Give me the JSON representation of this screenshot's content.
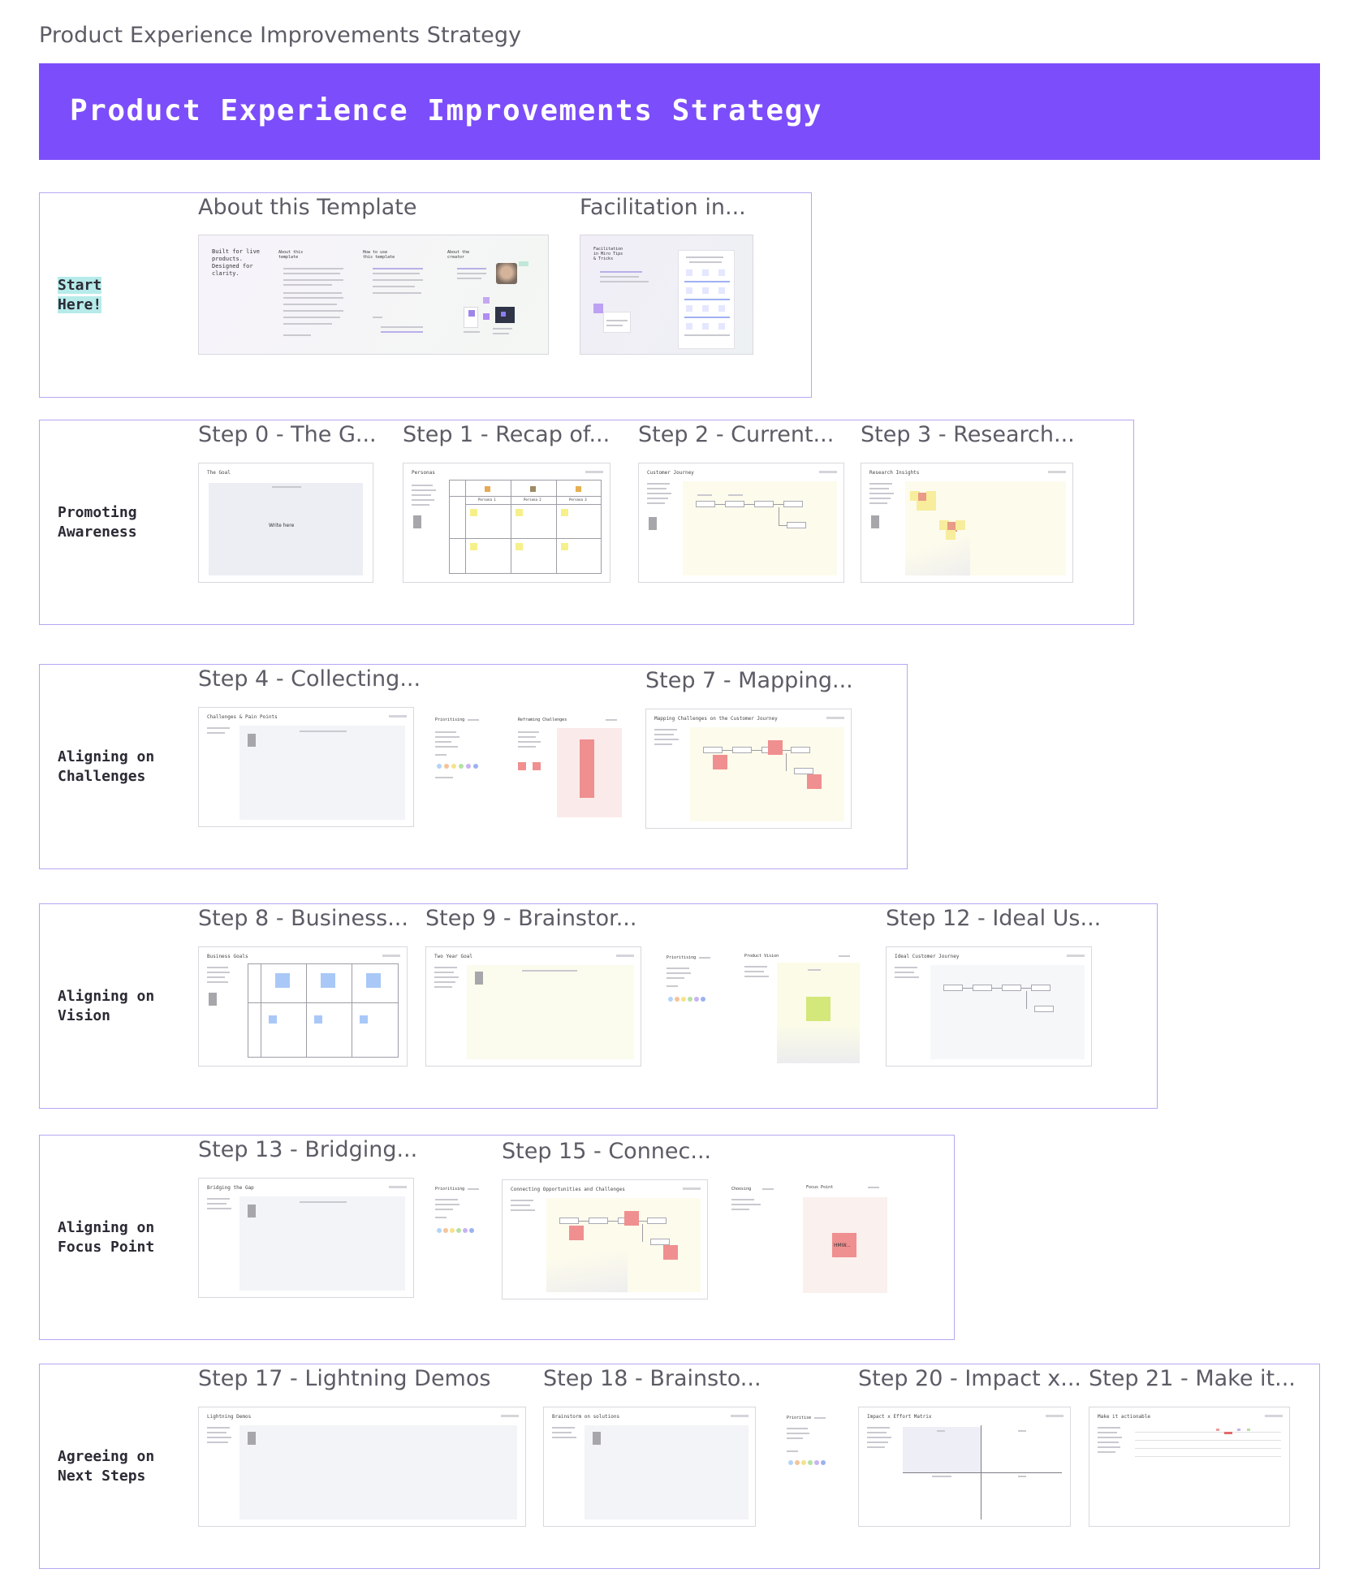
{
  "breadcrumb": "Product Experience Improvements Strategy",
  "banner": {
    "title": "Product Experience Improvements Strategy",
    "color": "#7c4dfa"
  },
  "sections": [
    {
      "label": "Start\nHere!",
      "cards": [
        "About this Template",
        "Facilitation in..."
      ]
    },
    {
      "label": "Promoting\nAwareness",
      "cards": [
        "Step 0 - The G...",
        "Step 1 - Recap of...",
        "Step 2 - Current...",
        "Step 3 - Research..."
      ]
    },
    {
      "label": "Aligning on\nChallenges",
      "cards": [
        "Step 4 - Collecting...",
        "Step 7 - Mapping..."
      ]
    },
    {
      "label": "Aligning on\nVision",
      "cards": [
        "Step 8 - Business...",
        "Step 9 - Brainstor...",
        "Step 12 - Ideal Us..."
      ]
    },
    {
      "label": "Aligning on\nFocus Point",
      "cards": [
        "Step 13 - Bridging...",
        "Step 15 - Connec..."
      ]
    },
    {
      "label": "Agreeing on\nNext Steps",
      "cards": [
        "Step 17 - Lightning Demos",
        "Step 18 - Brainsto...",
        "Step 20 - Impact x...",
        "Step 21 - Make it..."
      ]
    }
  ],
  "thumbs": {
    "about_intro": "Built for live\nproducts.\nDesigned for\nclarity.",
    "about_col1": "About this\ntemplate",
    "about_col2": "How to use\nthis template",
    "about_col3": "About the\ncreator",
    "facilitation": "Facilitation\nin Miro Tips\n& Tricks",
    "goal": "The Goal",
    "write_here": "Write here",
    "personas": "Personas",
    "persona_1": "Persona 1",
    "persona_2": "Persona 2",
    "persona_3": "Persona 3",
    "customer_journey": "Customer Journey",
    "research_insights": "Research Insights",
    "challenges": "Challenges & Pain Points",
    "prioritising": "Prioritising",
    "reframing": "Reframing Challenges",
    "mapping": "Mapping Challenges on the Customer Journey",
    "business_goals": "Business Goals",
    "two_year_goal": "Two Year Goal",
    "product_vision": "Product Vision",
    "ideal_journey": "Ideal Customer Journey",
    "bridging": "Bridging the Gap",
    "connecting": "Connecting Opportunities and Challenges",
    "choosing": "Choosing",
    "focus_point": "Focus Point",
    "hmw": "HMW...",
    "lightning": "Lightning Demos",
    "brainstorm_solutions": "Brainstorm on solutions",
    "prioritise": "Prioritise",
    "impact_effort": "Impact x Effort Matrix",
    "make_actionable": "Make it actionable"
  },
  "colors": {
    "section_border": "#b7a6f3",
    "label_highlight": "#b7ebea",
    "sticky_yellow": "#f6f08a",
    "sticky_red": "#f08f8f",
    "sticky_blue": "#a9c8f7",
    "sticky_green": "#d4e77a"
  }
}
